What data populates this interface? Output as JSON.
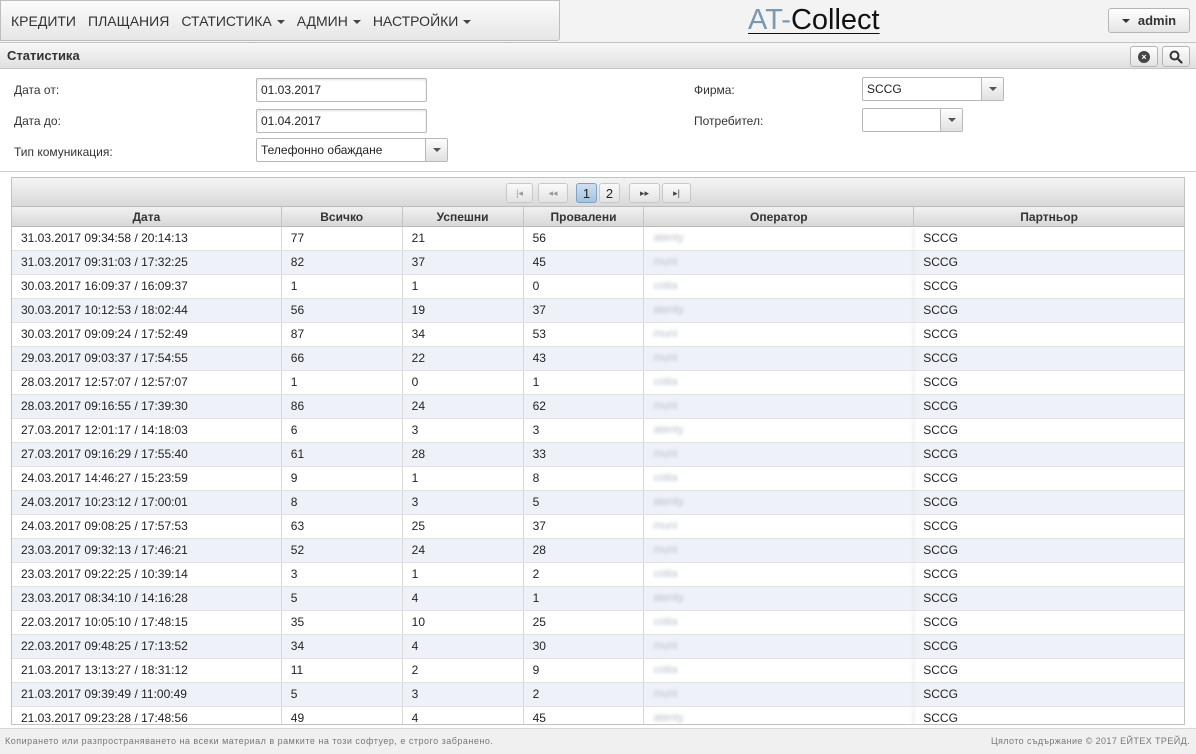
{
  "nav": {
    "items": [
      {
        "label": "КРЕДИТИ",
        "dropdown": false
      },
      {
        "label": "ПЛАЩАНИЯ",
        "dropdown": false
      },
      {
        "label": "СТАТИСТИКА",
        "dropdown": true
      },
      {
        "label": "АДМИН",
        "dropdown": true
      },
      {
        "label": "НАСТРОЙКИ",
        "dropdown": true
      }
    ]
  },
  "brand": {
    "prefix": "AT-",
    "name": "Collect"
  },
  "user": {
    "label": "admin"
  },
  "panel": {
    "title": "Статистика"
  },
  "filters": {
    "date_from_label": "Дата от:",
    "date_from_value": "01.03.2017",
    "date_to_label": "Дата до:",
    "date_to_value": "01.04.2017",
    "comm_type_label": "Тип комуникация:",
    "comm_type_value": "Телефонно обаждане",
    "company_label": "Фирма:",
    "company_value": "SCCG",
    "user_label": "Потребител:",
    "user_value": ""
  },
  "pager": {
    "first": "|◂",
    "prev": "◂◂",
    "pages": [
      "1",
      "2"
    ],
    "current": "1",
    "next": "▸▸",
    "last": "▸|"
  },
  "table": {
    "columns": [
      "Дата",
      "Всичко",
      "Успешни",
      "Провалени",
      "Оператор",
      "Партньор"
    ],
    "rows": [
      [
        "31.03.2017 09:34:58 / 20:14:13",
        "77",
        "21",
        "56",
        "atenty",
        "SCCG"
      ],
      [
        "31.03.2017 09:31:03 / 17:32:25",
        "82",
        "37",
        "45",
        "muni",
        "SCCG"
      ],
      [
        "30.03.2017 16:09:37 / 16:09:37",
        "1",
        "1",
        "0",
        "cotta",
        "SCCG"
      ],
      [
        "30.03.2017 10:12:53 / 18:02:44",
        "56",
        "19",
        "37",
        "atenty",
        "SCCG"
      ],
      [
        "30.03.2017 09:09:24 / 17:52:49",
        "87",
        "34",
        "53",
        "muni",
        "SCCG"
      ],
      [
        "29.03.2017 09:03:37 / 17:54:55",
        "66",
        "22",
        "43",
        "muni",
        "SCCG"
      ],
      [
        "28.03.2017 12:57:07 / 12:57:07",
        "1",
        "0",
        "1",
        "cotta",
        "SCCG"
      ],
      [
        "28.03.2017 09:16:55 / 17:39:30",
        "86",
        "24",
        "62",
        "muni",
        "SCCG"
      ],
      [
        "27.03.2017 12:01:17 / 14:18:03",
        "6",
        "3",
        "3",
        "atenty",
        "SCCG"
      ],
      [
        "27.03.2017 09:16:29 / 17:55:40",
        "61",
        "28",
        "33",
        "muni",
        "SCCG"
      ],
      [
        "24.03.2017 14:46:27 / 15:23:59",
        "9",
        "1",
        "8",
        "cotta",
        "SCCG"
      ],
      [
        "24.03.2017 10:23:12 / 17:00:01",
        "8",
        "3",
        "5",
        "atenty",
        "SCCG"
      ],
      [
        "24.03.2017 09:08:25 / 17:57:53",
        "63",
        "25",
        "37",
        "muni",
        "SCCG"
      ],
      [
        "23.03.2017 09:32:13 / 17:46:21",
        "52",
        "24",
        "28",
        "muni",
        "SCCG"
      ],
      [
        "23.03.2017 09:22:25 / 10:39:14",
        "3",
        "1",
        "2",
        "cotta",
        "SCCG"
      ],
      [
        "23.03.2017 08:34:10 / 14:16:28",
        "5",
        "4",
        "1",
        "atenty",
        "SCCG"
      ],
      [
        "22.03.2017 10:05:10 / 17:48:15",
        "35",
        "10",
        "25",
        "cotta",
        "SCCG"
      ],
      [
        "22.03.2017 09:48:25 / 17:13:52",
        "34",
        "4",
        "30",
        "muni",
        "SCCG"
      ],
      [
        "21.03.2017 13:13:27 / 18:31:12",
        "11",
        "2",
        "9",
        "cotta",
        "SCCG"
      ],
      [
        "21.03.2017 09:39:49 / 11:00:49",
        "5",
        "3",
        "2",
        "muni",
        "SCCG"
      ],
      [
        "21.03.2017 09:23:28 / 17:48:56",
        "49",
        "4",
        "45",
        "atenty",
        "SCCG"
      ]
    ]
  },
  "footer": {
    "left": "Копирането или разпространяването на всеки материал в рамките на този софтуер, е строго забранено.",
    "right": "Цялото съдържание © 2017 ЕЙТЕХ ТРЕЙД."
  }
}
